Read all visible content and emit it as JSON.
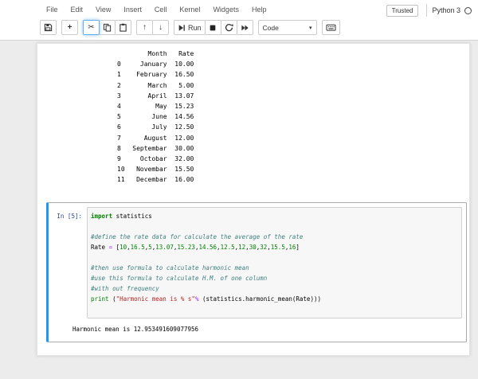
{
  "menu": {
    "items": [
      "File",
      "Edit",
      "View",
      "Insert",
      "Cell",
      "Kernel",
      "Widgets",
      "Help"
    ]
  },
  "header": {
    "trusted_label": "Trusted",
    "kernel_name": "Python 3"
  },
  "toolbar": {
    "run_label": "Run",
    "cell_type_selected": "Code",
    "icons": {
      "save": "floppy-disk",
      "add": "+",
      "cut": "✂",
      "copy": "copy-pages",
      "paste": "clipboard",
      "up": "↑",
      "down": "↓",
      "run": "step-forward",
      "stop": "black-square",
      "restart": "circular-arrow",
      "restart_run_all": "fast-forward",
      "caret": "▾",
      "command_palette": "keyboard"
    }
  },
  "output_table": {
    "text": "        Month   Rate\n0     January  10.00\n1    February  16.50\n2       March   5.00\n3       April  13.07\n4         May  15.23\n5        June  14.56\n6        July  12.50\n7      August  12.00\n8   Septembar  30.00\n9     Octobar  32.00\n10   Novembar  15.50\n11   Decembar  16.00"
  },
  "cell": {
    "prompt": "In [5]:",
    "code_lines": [
      [
        [
          "kw",
          "import"
        ],
        [
          "plain",
          " statistics"
        ]
      ],
      [],
      [
        [
          "comment",
          "#define the rate data for calculate the average of the rate"
        ]
      ],
      [
        [
          "plain",
          "Rate "
        ],
        [
          "op",
          "="
        ],
        [
          "plain",
          " ["
        ],
        [
          "num",
          "10"
        ],
        [
          "plain",
          ","
        ],
        [
          "num",
          "16.5"
        ],
        [
          "plain",
          ","
        ],
        [
          "num",
          "5"
        ],
        [
          "plain",
          ","
        ],
        [
          "num",
          "13.07"
        ],
        [
          "plain",
          ","
        ],
        [
          "num",
          "15.23"
        ],
        [
          "plain",
          ","
        ],
        [
          "num",
          "14.56"
        ],
        [
          "plain",
          ","
        ],
        [
          "num",
          "12.5"
        ],
        [
          "plain",
          ","
        ],
        [
          "num",
          "12"
        ],
        [
          "plain",
          ","
        ],
        [
          "num",
          "30"
        ],
        [
          "plain",
          ","
        ],
        [
          "num",
          "32"
        ],
        [
          "plain",
          ","
        ],
        [
          "num",
          "15.5"
        ],
        [
          "plain",
          ","
        ],
        [
          "num",
          "16"
        ],
        [
          "plain",
          "]"
        ]
      ],
      [],
      [
        [
          "comment",
          "#then use formula to calculate harmonic mean"
        ]
      ],
      [
        [
          "comment",
          "#use this formula to calculate H.M. of one column"
        ]
      ],
      [
        [
          "comment",
          "#with out frequency"
        ]
      ],
      [
        [
          "builtin",
          "print"
        ],
        [
          "plain",
          " ("
        ],
        [
          "str",
          "\"Harmonic mean is % s\""
        ],
        [
          "op",
          "%"
        ],
        [
          "plain",
          " (statistics.harmonic_mean(Rate)))"
        ]
      ],
      []
    ],
    "output_text": "Harmonic mean is 12.953491609077956"
  }
}
